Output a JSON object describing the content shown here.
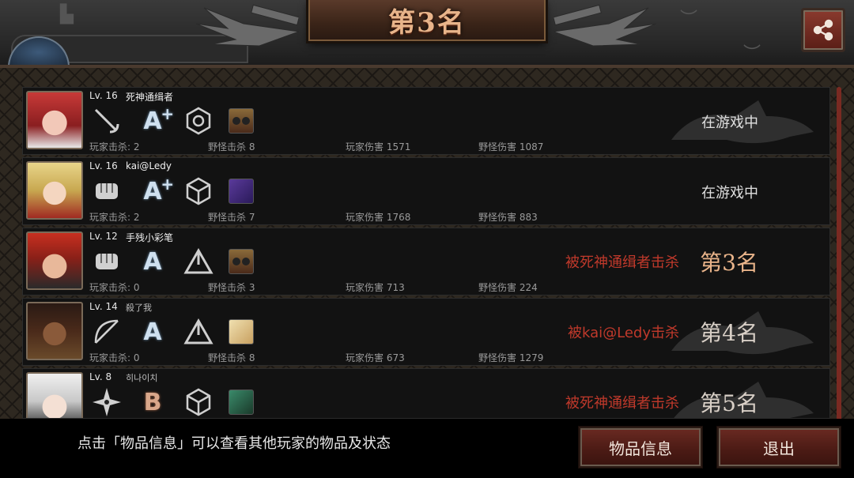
{
  "header": {
    "title": "第3名",
    "share_icon": "share-icon"
  },
  "players": [
    {
      "level": "Lv. 16",
      "name": "死神通缉者",
      "weapon_icon": "rapier-icon",
      "grade": "A",
      "grade_plus": "+",
      "skill_icon": "hex-crystal-icon",
      "item_icon": "binoculars-icon",
      "player_kills": "玩家击杀: 2",
      "monster_kills": "野怪击杀 8",
      "player_damage": "玩家伤害 1571",
      "monster_damage": "野怪伤害 1087",
      "status": "在游戏中",
      "killed_by": "",
      "rank": ""
    },
    {
      "level": "Lv. 16",
      "name": "kai@Ledy",
      "weapon_icon": "glove-icon",
      "grade": "A",
      "grade_plus": "+",
      "skill_icon": "cube-icon",
      "item_icon": "purple-scroll-icon",
      "player_kills": "玩家击杀: 2",
      "monster_kills": "野怪击杀 7",
      "player_damage": "玩家伤害 1768",
      "monster_damage": "野怪伤害 883",
      "status": "在游戏中",
      "killed_by": "",
      "rank": ""
    },
    {
      "level": "Lv. 12",
      "name": "手残小彩笔",
      "weapon_icon": "glove-icon",
      "grade": "A",
      "grade_plus": "",
      "skill_icon": "triangle-icon",
      "item_icon": "binoculars-icon",
      "player_kills": "玩家击杀: 0",
      "monster_kills": "野怪击杀 3",
      "player_damage": "玩家伤害 713",
      "monster_damage": "野怪伤害 224",
      "status": "",
      "killed_by": "被死神通缉者击杀",
      "rank": "第3名"
    },
    {
      "level": "Lv. 14",
      "name": "殺了我",
      "weapon_icon": "bow-icon",
      "grade": "A",
      "grade_plus": "",
      "skill_icon": "triangle-icon",
      "item_icon": "bandage-icon",
      "player_kills": "玩家击杀: 0",
      "monster_kills": "野怪击杀 8",
      "player_damage": "玩家伤害 673",
      "monster_damage": "野怪伤害 1279",
      "status": "",
      "killed_by": "被kai@Ledy击杀",
      "rank": "第4名"
    },
    {
      "level": "Lv. 8",
      "name": "히나이치",
      "weapon_icon": "shuriken-icon",
      "grade": "B",
      "grade_plus": "",
      "skill_icon": "cube-icon",
      "item_icon": "green-potion-icon",
      "player_kills": "",
      "monster_kills": "",
      "player_damage": "",
      "monster_damage": "",
      "status": "",
      "killed_by": "被死神通缉者击杀",
      "rank": "第5名"
    }
  ],
  "footer": {
    "hint": "点击「物品信息」可以查看其他玩家的物品及状态",
    "items_button": "物品信息",
    "exit_button": "退出"
  },
  "colors": {
    "accent": "#c0392b",
    "button": "#5a1e16",
    "rank_highlight": "#e9b48a"
  }
}
